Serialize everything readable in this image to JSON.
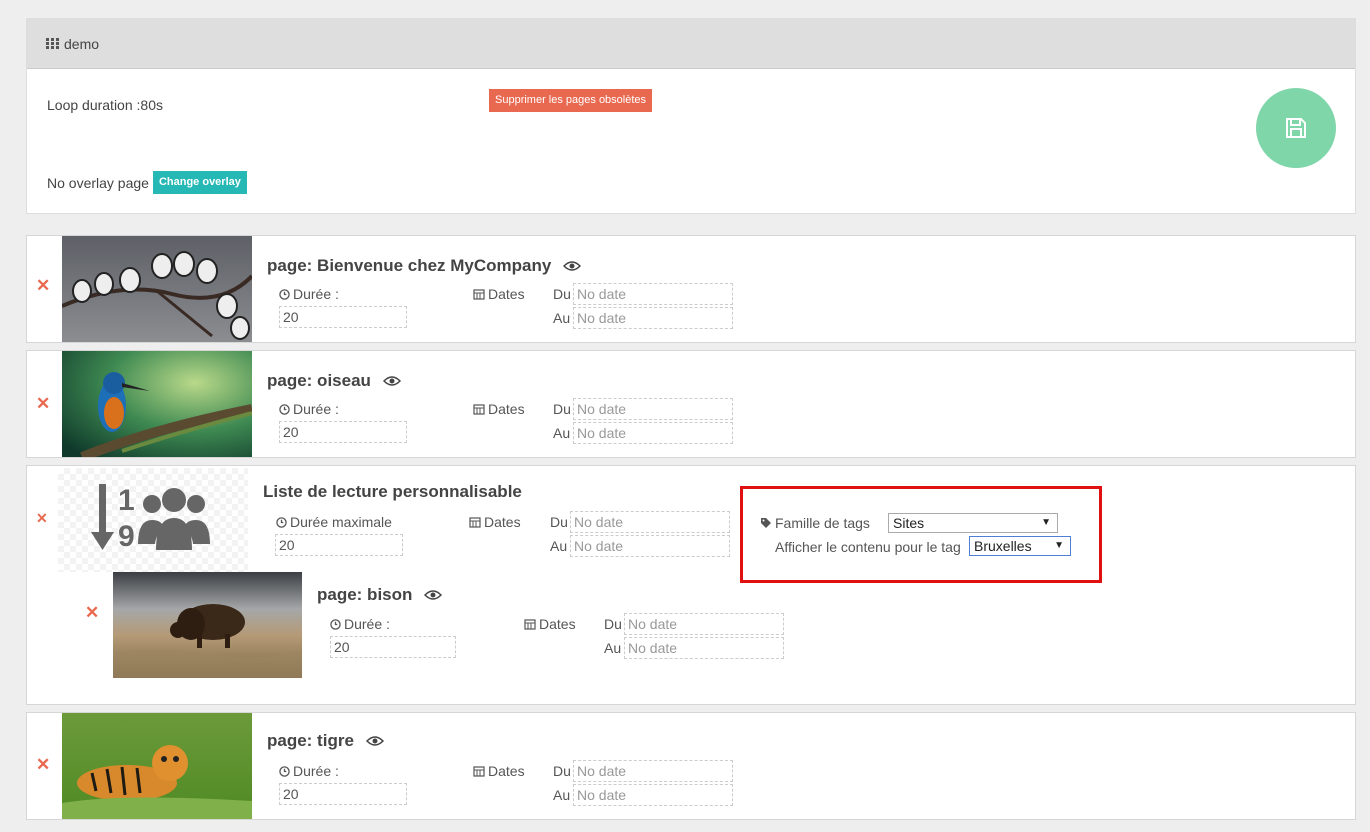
{
  "header": {
    "title": "demo"
  },
  "settings": {
    "loop_duration": "Loop duration :80s",
    "delete_obsolete_label": "Supprimer les pages obsolètes",
    "overlay_text": "No overlay page",
    "change_overlay_label": "Change overlay"
  },
  "labels": {
    "duree": "Durée :",
    "duree_max": "Durée maximale",
    "dates": "Dates",
    "du": "Du",
    "au": "Au",
    "no_date": "No date"
  },
  "pages": [
    {
      "title": "page: Bienvenue chez MyCompany",
      "duration": "20",
      "thumb": "birds-on-branch"
    },
    {
      "title": "page: oiseau",
      "duration": "20",
      "thumb": "kingfisher"
    },
    {
      "title": "page: tigre",
      "duration": "20",
      "thumb": "tiger"
    }
  ],
  "playlist": {
    "title": "Liste de lecture personnalisable",
    "duration": "20",
    "icon": "sort-numeric-users-icon",
    "tag_family_label": "Famille de tags",
    "tag_family_value": "Sites",
    "tag_content_label": "Afficher le contenu pour le tag",
    "tag_content_value": "Bruxelles",
    "subpage": {
      "title": "page: bison",
      "duration": "20",
      "thumb": "bison"
    }
  },
  "colors": {
    "danger": "#e8694f",
    "teal": "#26b8b5",
    "save": "#7fd6a9",
    "highlight": "#e01010"
  }
}
